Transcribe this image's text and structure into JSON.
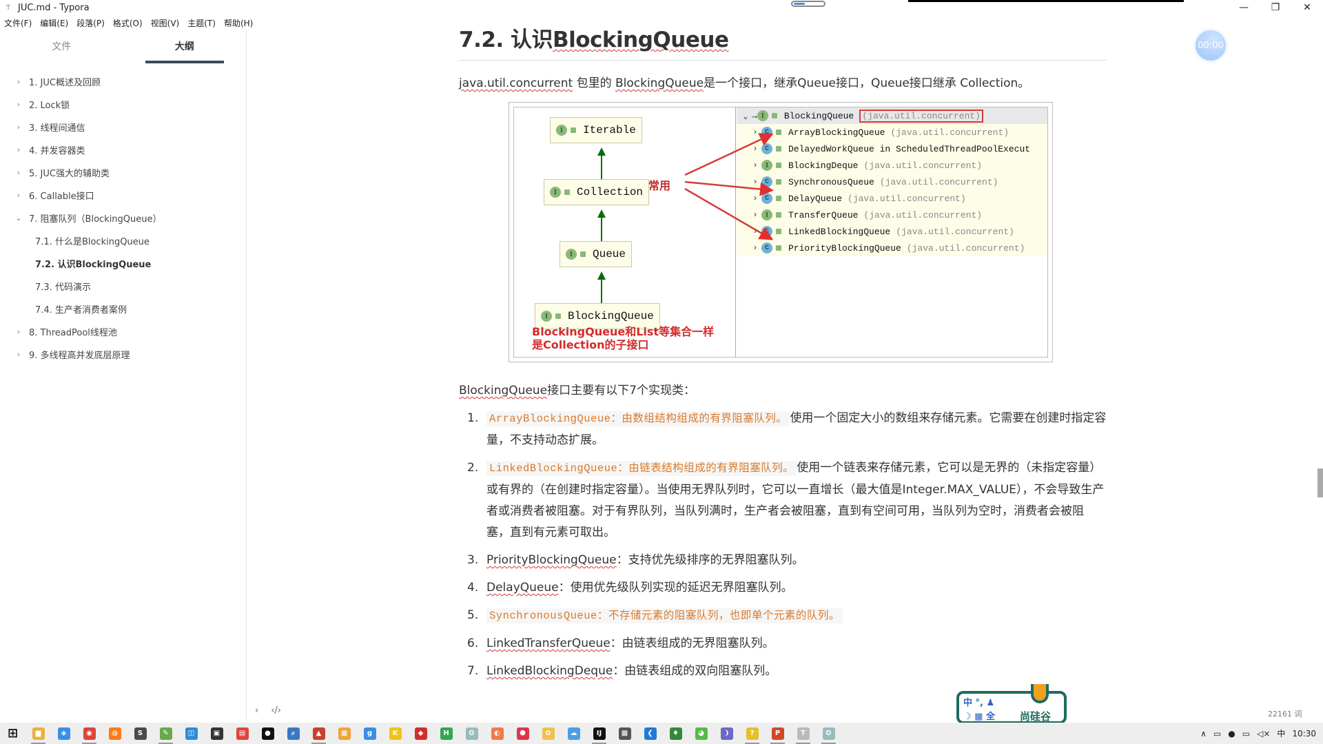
{
  "window": {
    "title": "JUC.md - Typora",
    "app_icon": "T",
    "minimize_icon": "—",
    "restore_icon": "❐",
    "close_icon": "✕",
    "loading_progress": 0.35
  },
  "menu": [
    "文件(F)",
    "编辑(E)",
    "段落(P)",
    "格式(O)",
    "视图(V)",
    "主题(T)",
    "帮助(H)"
  ],
  "sidebar": {
    "tabs": [
      {
        "label": "文件",
        "active": false
      },
      {
        "label": "大纲",
        "active": true
      }
    ],
    "outline": [
      {
        "label": "1. JUC概述及回顾",
        "level": 1,
        "chevron": "›"
      },
      {
        "label": "2. Lock锁",
        "level": 1,
        "chevron": "›"
      },
      {
        "label": "3. 线程间通信",
        "level": 1,
        "chevron": "›"
      },
      {
        "label": "4. 并发容器类",
        "level": 1,
        "chevron": "›"
      },
      {
        "label": "5. JUC强大的辅助类",
        "level": 1,
        "chevron": "›"
      },
      {
        "label": "6. Callable接口",
        "level": 1,
        "chevron": "›"
      },
      {
        "label": "7. 阻塞队列（BlockingQueue）",
        "level": 1,
        "chevron": "⌄"
      },
      {
        "label": "7.1. 什么是BlockingQueue",
        "level": 2
      },
      {
        "label": "7.2. 认识BlockingQueue",
        "level": 2,
        "active": true
      },
      {
        "label": "7.3. 代码演示",
        "level": 2
      },
      {
        "label": "7.4. 生产者消费者案例",
        "level": 2
      },
      {
        "label": "8. ThreadPool线程池",
        "level": 1,
        "chevron": "›"
      },
      {
        "label": "9. 多线程高并发底层原理",
        "level": 1,
        "chevron": "›"
      }
    ]
  },
  "doc": {
    "heading_prefix": "7.2. 认识",
    "heading_word": "BlockingQueue",
    "intro": {
      "pkg": "java.util.concurrent",
      "t1": " 包里的 ",
      "cls": "BlockingQueue",
      "t2": "是一个接口，继承Queue接口，Queue接口继承 Collection。"
    },
    "figure": {
      "uml": [
        "Iterable",
        "Collection",
        "Queue",
        "BlockingQueue"
      ],
      "badge_interface": "I",
      "badge_class": "C",
      "note_line1": "BlockingQueue和List等集合一样",
      "note_line2": "是Collection的子接口",
      "common_label": "常用",
      "tree_root": {
        "name": "BlockingQueue",
        "pkg": "(java.util.concurrent)"
      },
      "tree_children": [
        {
          "kind": "C",
          "name": "ArrayBlockingQueue",
          "pkg": "(java.util.concurrent)"
        },
        {
          "kind": "C",
          "name": "DelayedWorkQueue in ScheduledThreadPoolExecut",
          "pkg": ""
        },
        {
          "kind": "I",
          "name": "BlockingDeque",
          "pkg": "(java.util.concurrent)"
        },
        {
          "kind": "C",
          "name": "SynchronousQueue",
          "pkg": "(java.util.concurrent)"
        },
        {
          "kind": "C",
          "name": "DelayQueue",
          "pkg": "(java.util.concurrent)"
        },
        {
          "kind": "I",
          "name": "TransferQueue",
          "pkg": "(java.util.concurrent)"
        },
        {
          "kind": "C",
          "name": "LinkedBlockingQueue",
          "pkg": "(java.util.concurrent)"
        },
        {
          "kind": "C",
          "name": "PriorityBlockingQueue",
          "pkg": "(java.util.concurrent)"
        }
      ]
    },
    "impl_intro": {
      "cls": "BlockingQueue",
      "rest": "接口主要有以下7个实现类："
    },
    "list": [
      {
        "num": "1.",
        "code": "ArrayBlockingQueue：由数组结构组成的有界阻塞队列。",
        "text": "使用一个固定大小的数组来存储元素。它需要在创建时指定容量，不支持动态扩展。"
      },
      {
        "num": "2.",
        "code": "LinkedBlockingQueue：由链表结构组成的有界阻塞队列。",
        "text": "使用一个链表来存储元素，它可以是无界的（未指定容量）或有界的（在创建时指定容量）。当使用无界队列时，它可以一直增长（最大值是Integer.MAX_VALUE），不会导致生产者或消费者被阻塞。对于有界队列，当队列满时，生产者会被阻塞，直到有空间可用，当队列为空时，消费者会被阻塞，直到有元素可取出。"
      },
      {
        "num": "3.",
        "name": "PriorityBlockingQueue",
        "text": "：支持优先级排序的无界阻塞队列。"
      },
      {
        "num": "4.",
        "name": "DelayQueue",
        "text": "：使用优先级队列实现的延迟无界阻塞队列。"
      },
      {
        "num": "5.",
        "code": "SynchronousQueue：不存储元素的阻塞队列，也即单个元素的队列。",
        "text": ""
      },
      {
        "num": "6.",
        "name": "LinkedTransferQueue",
        "text": "：由链表组成的无界阻塞队列。"
      },
      {
        "num": "7.",
        "name": "LinkedBlockingDeque",
        "text": "：由链表组成的双向阻塞队列。"
      }
    ]
  },
  "timer": "00:00",
  "footer": {
    "back_icon": "‹",
    "source_icon": "‹/›",
    "word_count": "22161 词"
  },
  "ime": {
    "row1": "中 °, ♟",
    "row2": "☽ ▦ 全",
    "brand": "尚硅谷"
  },
  "taskbar": {
    "icons": [
      {
        "name": "windows-start-icon",
        "glyph": "⊞",
        "color": "#111"
      },
      {
        "name": "file-explorer-icon",
        "glyph": "▆",
        "color": "#e8b23c",
        "running": true
      },
      {
        "name": "baidu-netdisk-icon",
        "glyph": "◈",
        "color": "#3a8ee6"
      },
      {
        "name": "chrome-icon",
        "glyph": "◉",
        "color": "#db4437",
        "running": true
      },
      {
        "name": "firefox-icon",
        "glyph": "◍",
        "color": "#ff7a1a"
      },
      {
        "name": "sublime-icon",
        "glyph": "S",
        "color": "#4a4a4a"
      },
      {
        "name": "notepad-icon",
        "glyph": "✎",
        "color": "#6aa84f",
        "running": true
      },
      {
        "name": "vmware-icon",
        "glyph": "◫",
        "color": "#2e8bd6"
      },
      {
        "name": "terminal-icon",
        "glyph": "▣",
        "color": "#333"
      },
      {
        "name": "pdf-icon",
        "glyph": "▤",
        "color": "#e0443a"
      },
      {
        "name": "qq-icon",
        "glyph": "●",
        "color": "#111"
      },
      {
        "name": "search-tool-icon",
        "glyph": "⌕",
        "color": "#3d76c2"
      },
      {
        "name": "xmind-icon",
        "glyph": "▲",
        "color": "#c94030",
        "running": true
      },
      {
        "name": "app-grid-icon",
        "glyph": "▦",
        "color": "#f2a33a"
      },
      {
        "name": "youdao-icon",
        "glyph": "g",
        "color": "#3a8ee6"
      },
      {
        "name": "k-app-icon",
        "glyph": "K",
        "color": "#f2c21a"
      },
      {
        "name": "redis-icon",
        "glyph": "◆",
        "color": "#d12f2f"
      },
      {
        "name": "hbuilder-icon",
        "glyph": "H",
        "color": "#2fa84f"
      },
      {
        "name": "network-icon",
        "glyph": "❂",
        "color": "#9bb"
      },
      {
        "name": "recorder-icon",
        "glyph": "◐",
        "color": "#f07a4a"
      },
      {
        "name": "red-app-icon",
        "glyph": "⬢",
        "color": "#e0344a"
      },
      {
        "name": "yellow-app-icon",
        "glyph": "✿",
        "color": "#f2c04a"
      },
      {
        "name": "weather-icon",
        "glyph": "☁",
        "color": "#4aa0e6"
      },
      {
        "name": "intellij-icon",
        "glyph": "IJ",
        "color": "#111",
        "running": true
      },
      {
        "name": "remote-desktop-icon",
        "glyph": "▩",
        "color": "#555"
      },
      {
        "name": "vscode-icon",
        "glyph": "❮",
        "color": "#1f7ad6"
      },
      {
        "name": "mongodb-icon",
        "glyph": "♦",
        "color": "#2f8a3a"
      },
      {
        "name": "wechat-icon",
        "glyph": "◕",
        "color": "#58b84a"
      },
      {
        "name": "mysql-icon",
        "glyph": "❩",
        "color": "#6a6ac4"
      },
      {
        "name": "help-doc-icon",
        "glyph": "?",
        "color": "#e6c02a",
        "running": true
      },
      {
        "name": "powerpoint-icon",
        "glyph": "P",
        "color": "#d2472a",
        "running": true
      },
      {
        "name": "typora-icon",
        "glyph": "T",
        "color": "#bbb",
        "running": true
      },
      {
        "name": "loader-icon",
        "glyph": "❂",
        "color": "#9bb",
        "running": true
      }
    ],
    "tray": {
      "chevron": "∧",
      "battery": "▭",
      "mic": "●",
      "display": "▭",
      "volume": "◁×",
      "ime": "中",
      "time": "10:30"
    }
  }
}
